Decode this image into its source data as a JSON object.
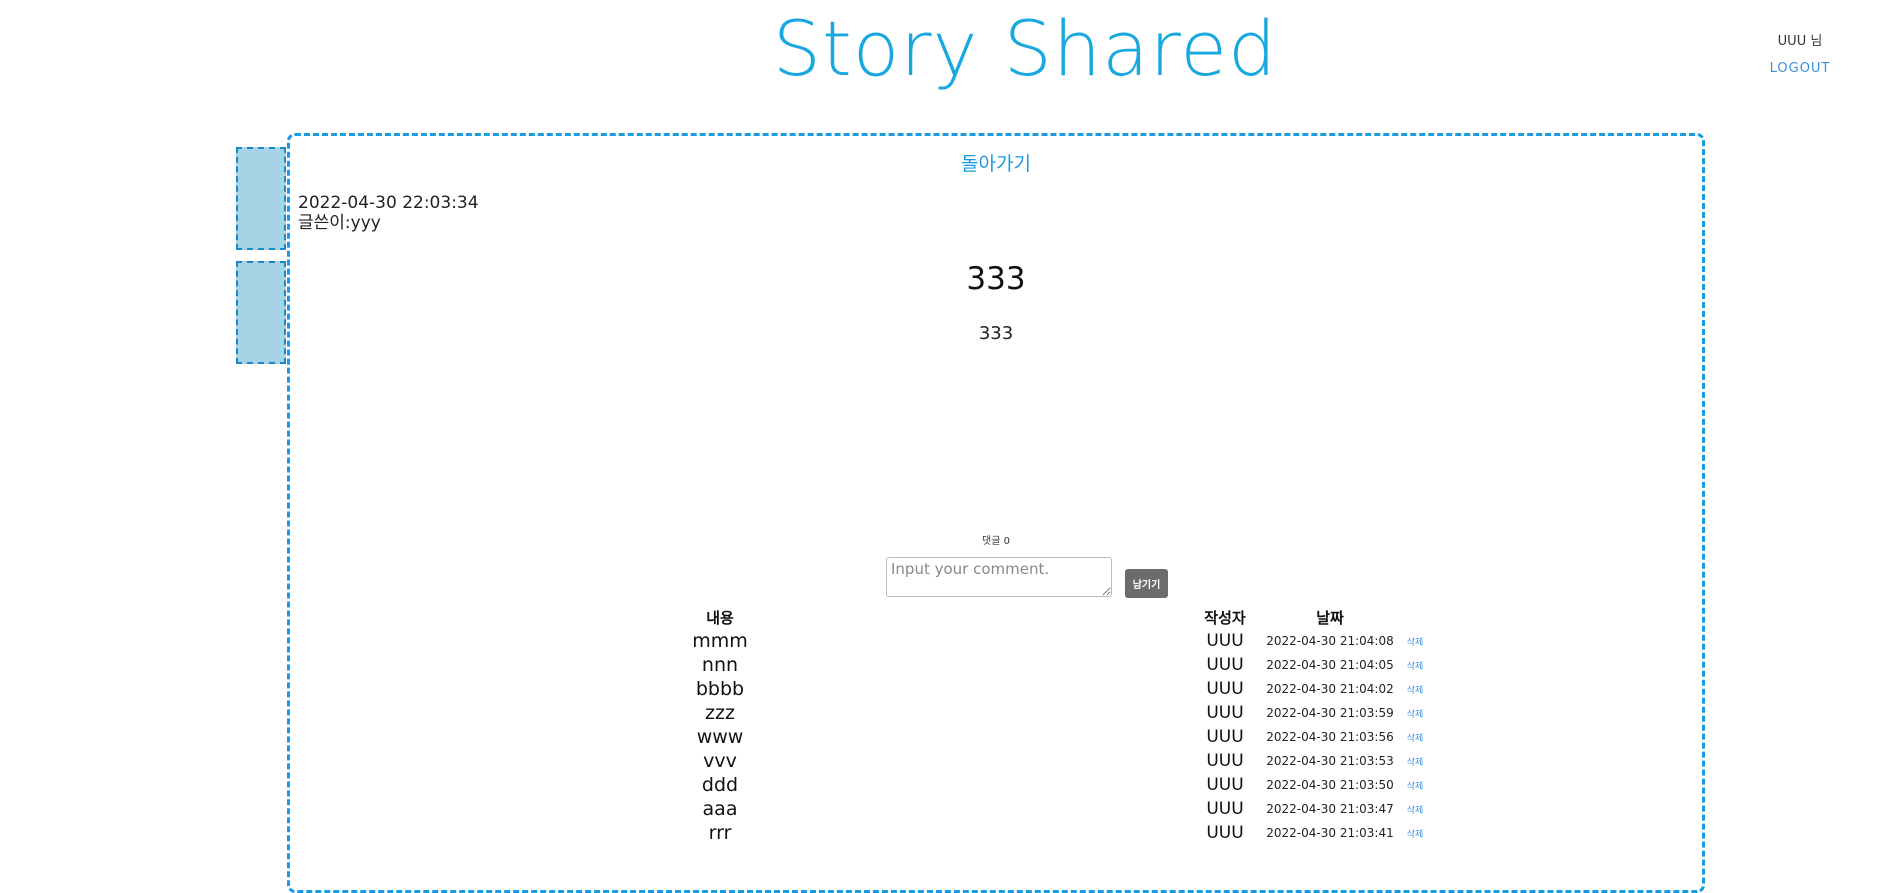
{
  "header": {
    "site_title": "Story Shared",
    "user_name": "UUU 님",
    "logout_label": "LOGOUT"
  },
  "colors": {
    "brand": "#18a8e0",
    "frame_border": "#1a9be0",
    "side_tab_fill": "#a6d3e6",
    "button_bg": "#6c6c6c",
    "link": "#3d8fd6"
  },
  "post": {
    "back_label": "돌아가기",
    "datetime": "2022-04-30 22:03:34",
    "author_line": "글쓴이:yyy",
    "title": "333",
    "body": "333"
  },
  "comments": {
    "count_label": "댓글 0",
    "input_placeholder": "Input your comment.",
    "submit_label": "남기기",
    "headers": {
      "content": "내용",
      "writer": "작성자",
      "date": "날짜"
    },
    "rows": [
      {
        "content": "mmm",
        "writer": "UUU",
        "date": "2022-04-30 21:04:08",
        "delete": "삭제"
      },
      {
        "content": "nnn",
        "writer": "UUU",
        "date": "2022-04-30 21:04:05",
        "delete": "삭제"
      },
      {
        "content": "bbbb",
        "writer": "UUU",
        "date": "2022-04-30 21:04:02",
        "delete": "삭제"
      },
      {
        "content": "zzz",
        "writer": "UUU",
        "date": "2022-04-30 21:03:59",
        "delete": "삭제"
      },
      {
        "content": "www",
        "writer": "UUU",
        "date": "2022-04-30 21:03:56",
        "delete": "삭제"
      },
      {
        "content": "vvv",
        "writer": "UUU",
        "date": "2022-04-30 21:03:53",
        "delete": "삭제"
      },
      {
        "content": "ddd",
        "writer": "UUU",
        "date": "2022-04-30 21:03:50",
        "delete": "삭제"
      },
      {
        "content": "aaa",
        "writer": "UUU",
        "date": "2022-04-30 21:03:47",
        "delete": "삭제"
      },
      {
        "content": "rrr",
        "writer": "UUU",
        "date": "2022-04-30 21:03:41",
        "delete": "삭제"
      }
    ]
  }
}
